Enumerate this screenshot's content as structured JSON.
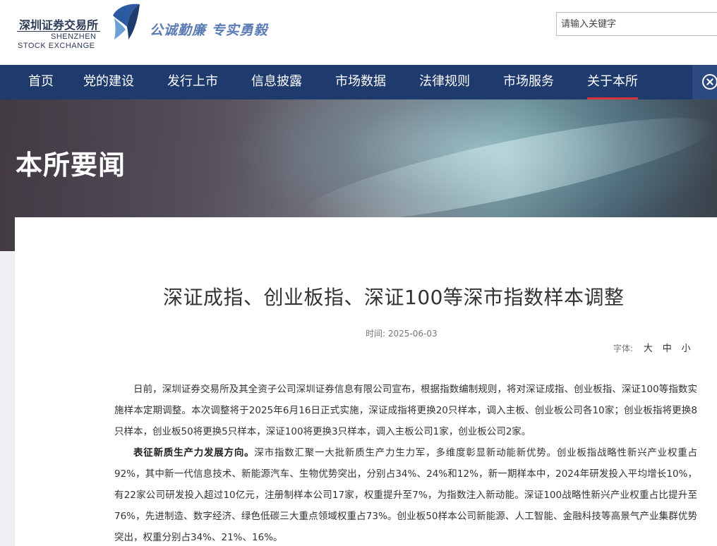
{
  "header": {
    "logo_cn": "深圳证券交易所",
    "logo_en_line1": "SHENZHEN",
    "logo_en_line2": "STOCK EXCHANGE",
    "slogan": "公诚勤廉  专实勇毅",
    "search_placeholder": "请输入关键字"
  },
  "nav": {
    "items": [
      {
        "label": "首页"
      },
      {
        "label": "党的建设"
      },
      {
        "label": "发行上市"
      },
      {
        "label": "信息披露"
      },
      {
        "label": "市场数据"
      },
      {
        "label": "法律规则"
      },
      {
        "label": "市场服务"
      },
      {
        "label": "关于本所"
      }
    ],
    "active": "关于本所"
  },
  "banner": {
    "title": "本所要闻"
  },
  "article": {
    "title": "深证成指、创业板指、深证100等深市指数样本调整",
    "time_label": "时间:",
    "time_value": "2025-06-03",
    "font_label": "字体:",
    "font_large": "大",
    "font_medium": "中",
    "font_small": "小",
    "para1": "日前，深圳证券交易所及其全资子公司深圳证券信息有限公司宣布，根据指数编制规则，将对深证成指、创业板指、深证100等指数实施样本定期调整。本次调整将于2025年6月16日正式实施，深证成指将更换20只样本，调入主板、创业板公司各10家；创业板指将更换8只样本，创业板50将更换5只样本，深证100将更换3只样本，调入主板公司1家，创业板公司2家。",
    "para2_bold": "表征新质生产力发展方向。",
    "para2": "深市指数汇聚一大批新质生产力生力军，多维度彰显新动能新优势。创业板指战略性新兴产业权重占92%，其中新一代信息技术、新能源汽车、生物优势突出，分别占34%、24%和12%，新一期样本中，2024年研发投入平均增长10%，有22家公司研发投入超过10亿元，注册制样本公司17家，权重提升至7%，为指数注入新动能。深证100战略性新兴产业权重占比提升至76%，先进制造、数字经济、绿色低碳三大重点领域权重占73%。创业板50样本公司新能源、人工智能、金融科技等高景气产业集群优势突出，权重分别占34%、21%、16%。"
  }
}
